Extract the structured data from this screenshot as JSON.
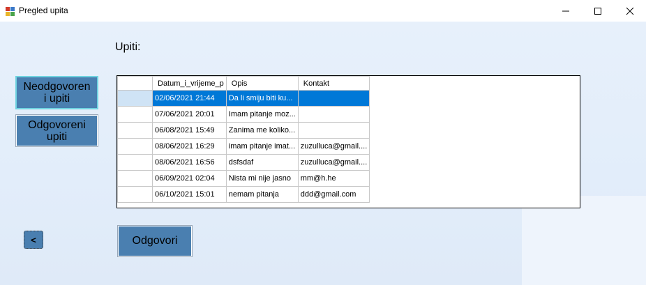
{
  "window": {
    "title": "Pregled upita",
    "minimize_icon": "minimize-icon",
    "maximize_icon": "maximize-icon",
    "close_icon": "close-icon"
  },
  "heading": "Upiti:",
  "nav": {
    "unanswered_label": "Neodgovoren\ni upiti",
    "answered_label": "Odgovoreni\nupiti",
    "back_label": "<"
  },
  "grid": {
    "columns": [
      "Datum_i_vrijeme_p",
      "Opis",
      "Kontakt"
    ],
    "selected_row_index": 0,
    "rows": [
      {
        "datum": "02/06/2021 21:44",
        "opis": "Da li smiju biti ku...",
        "kontakt": ""
      },
      {
        "datum": "07/06/2021 20:01",
        "opis": "Imam pitanje moz...",
        "kontakt": ""
      },
      {
        "datum": "06/08/2021 15:49",
        "opis": "Zanima me koliko...",
        "kontakt": ""
      },
      {
        "datum": "08/06/2021 16:29",
        "opis": "imam pitanje imat...",
        "kontakt": "zuzulluca@gmail...."
      },
      {
        "datum": "08/06/2021 16:56",
        "opis": "dsfsdaf",
        "kontakt": "zuzulluca@gmail...."
      },
      {
        "datum": "06/09/2021 02:04",
        "opis": "Nista mi nije jasno",
        "kontakt": "mm@h.he"
      },
      {
        "datum": "06/10/2021 15:01",
        "opis": "nemam pitanja",
        "kontakt": "ddd@gmail.com"
      }
    ]
  },
  "actions": {
    "reply_label": "Odgovori"
  },
  "colors": {
    "button_fill": "#4a7fb0",
    "selection": "#0078d7",
    "active_border": "#6fd3e0"
  }
}
